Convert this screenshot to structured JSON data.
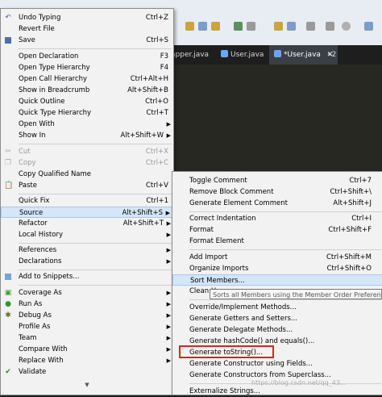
{
  "ide": {
    "tabs": [
      "apper.java",
      "User.java",
      "*User.java"
    ],
    "tab_overflow": "»2"
  },
  "main_menu": {
    "items": [
      {
        "label": "Undo Typing",
        "accel": "Ctrl+Z"
      },
      {
        "label": "Revert File",
        "accel": ""
      },
      {
        "label": "Save",
        "accel": "Ctrl+S"
      },
      {
        "label": "Open Declaration",
        "accel": "F3"
      },
      {
        "label": "Open Type Hierarchy",
        "accel": "F4"
      },
      {
        "label": "Open Call Hierarchy",
        "accel": "Ctrl+Alt+H"
      },
      {
        "label": "Show in Breadcrumb",
        "accel": "Alt+Shift+B"
      },
      {
        "label": "Quick Outline",
        "accel": "Ctrl+O"
      },
      {
        "label": "Quick Type Hierarchy",
        "accel": "Ctrl+T"
      },
      {
        "label": "Open With",
        "accel": ""
      },
      {
        "label": "Show In",
        "accel": "Alt+Shift+W"
      },
      {
        "label": "Cut",
        "accel": "Ctrl+X"
      },
      {
        "label": "Copy",
        "accel": "Ctrl+C"
      },
      {
        "label": "Copy Qualified Name",
        "accel": ""
      },
      {
        "label": "Paste",
        "accel": "Ctrl+V"
      },
      {
        "label": "Quick Fix",
        "accel": "Ctrl+1"
      },
      {
        "label": "Source",
        "accel": "Alt+Shift+S"
      },
      {
        "label": "Refactor",
        "accel": "Alt+Shift+T"
      },
      {
        "label": "Local History",
        "accel": ""
      },
      {
        "label": "References",
        "accel": ""
      },
      {
        "label": "Declarations",
        "accel": ""
      },
      {
        "label": "Add to Snippets...",
        "accel": ""
      },
      {
        "label": "Coverage As",
        "accel": ""
      },
      {
        "label": "Run As",
        "accel": ""
      },
      {
        "label": "Debug As",
        "accel": ""
      },
      {
        "label": "Profile As",
        "accel": ""
      },
      {
        "label": "Team",
        "accel": ""
      },
      {
        "label": "Compare With",
        "accel": ""
      },
      {
        "label": "Replace With",
        "accel": ""
      },
      {
        "label": "Validate",
        "accel": ""
      }
    ]
  },
  "source_menu": {
    "items": [
      {
        "label": "Toggle Comment",
        "accel": "Ctrl+7"
      },
      {
        "label": "Remove Block Comment",
        "accel": "Ctrl+Shift+\\"
      },
      {
        "label": "Generate Element Comment",
        "accel": "Alt+Shift+J"
      },
      {
        "label": "Correct Indentation",
        "accel": "Ctrl+I"
      },
      {
        "label": "Format",
        "accel": "Ctrl+Shift+F"
      },
      {
        "label": "Format Element",
        "accel": ""
      },
      {
        "label": "Add Import",
        "accel": "Ctrl+Shift+M"
      },
      {
        "label": "Organize Imports",
        "accel": "Ctrl+Shift+O"
      },
      {
        "label": "Sort Members...",
        "accel": ""
      },
      {
        "label": "Clean Up...",
        "accel": ""
      },
      {
        "label": "Override/Implement Methods...",
        "accel": ""
      },
      {
        "label": "Generate Getters and Setters...",
        "accel": ""
      },
      {
        "label": "Generate Delegate Methods...",
        "accel": ""
      },
      {
        "label": "Generate hashCode() and equals()...",
        "accel": ""
      },
      {
        "label": "Generate toString()...",
        "accel": ""
      },
      {
        "label": "Generate Constructor using Fields...",
        "accel": ""
      },
      {
        "label": "Generate Constructors from Superclass...",
        "accel": ""
      },
      {
        "label": "Externalize Strings...",
        "accel": ""
      }
    ]
  },
  "tooltip": "Sorts all Members using the Member Order Preference",
  "watermark": "https://blog.csdn.net/qq_43...",
  "colors": {
    "highlight": "#d4e6f8",
    "annotation_box": "#d8261d",
    "menu_bg": "#f2f2f2"
  }
}
